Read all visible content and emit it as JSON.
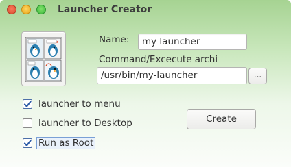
{
  "window": {
    "title": "Launcher Creator"
  },
  "form": {
    "name_label": "Name:",
    "name_value": "my launcher",
    "command_label": "Command/Excecute archi",
    "command_value": "/usr/bin/my-launcher",
    "browse_label": "..."
  },
  "options": [
    {
      "label": "launcher to menu",
      "checked": true
    },
    {
      "label": "launcher to Desktop",
      "checked": false
    },
    {
      "label": "Run as Root",
      "checked": true
    }
  ],
  "actions": {
    "create_label": "Create"
  },
  "colors": {
    "titlebar_green": "#a6d392",
    "check_blue": "#2f5ea8"
  },
  "icons": [
    "close-icon",
    "minimize-icon",
    "maximize-icon",
    "launcher-comic-icon",
    "checkmark-icon"
  ]
}
